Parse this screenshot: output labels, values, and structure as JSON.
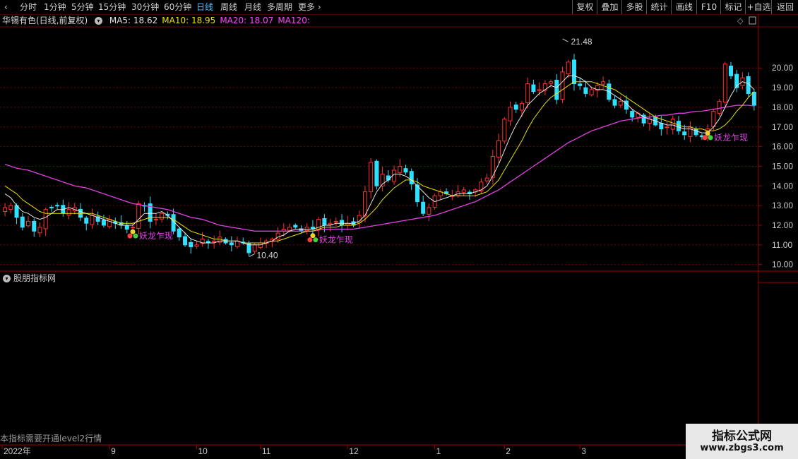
{
  "toolbar": {
    "periods": [
      "分时",
      "1分钟",
      "5分钟",
      "15分钟",
      "30分钟",
      "60分钟",
      "日线",
      "周线",
      "月线",
      "多周期",
      "更多"
    ],
    "active": "日线",
    "right_buttons": [
      "复权",
      "叠加",
      "多股",
      "统计",
      "画线",
      "F10",
      "标记",
      "+自选",
      "返回"
    ]
  },
  "stock": {
    "title": "华锡有色(日线,前复权)",
    "ma_labels": [
      {
        "text": "MA5: 18.62",
        "color": "#e0e0e0"
      },
      {
        "text": "MA10: 18.95",
        "color": "#e8e000"
      },
      {
        "text": "MA20: 18.07",
        "color": "#ff44ff"
      },
      {
        "text": "MA120:",
        "color": "#ff44ff"
      }
    ]
  },
  "subpanel": {
    "title": "股朋指标网"
  },
  "footer": {
    "note": "本指标需要开通level2行情"
  },
  "watermark": {
    "line1": "指标公式网",
    "line2": "www.zbgs3.com"
  },
  "chart_data": {
    "type": "candlestick",
    "ylim": [
      9.7,
      22.2
    ],
    "yticks": [
      10.0,
      11.0,
      12.0,
      13.0,
      14.0,
      15.0,
      16.0,
      17.0,
      18.0,
      19.0,
      20.0
    ],
    "x_labels": [
      {
        "text": "2022年",
        "index": 0
      },
      {
        "text": "9",
        "index": 18
      },
      {
        "text": "10",
        "index": 33
      },
      {
        "text": "11",
        "index": 44
      },
      {
        "text": "12",
        "index": 59
      },
      {
        "text": "1",
        "index": 74
      },
      {
        "text": "2",
        "index": 86
      },
      {
        "text": "3",
        "index": 99
      }
    ],
    "annotations": {
      "max": {
        "text": "21.48",
        "index": 96,
        "value": 21.48
      },
      "min": {
        "text": "10.40",
        "index": 42,
        "value": 10.4
      }
    },
    "signal_label": "妖龙乍现",
    "signals": [
      22,
      53,
      121
    ],
    "candles_close": [
      12.9,
      13.0,
      12.4,
      11.9,
      12.2,
      11.7,
      11.9,
      12.8,
      12.9,
      13.0,
      12.6,
      12.8,
      12.9,
      12.4,
      12.1,
      12.5,
      12.2,
      12.0,
      12.3,
      12.1,
      12.0,
      11.8,
      11.9,
      13.1,
      13.0,
      12.2,
      12.3,
      12.6,
      12.5,
      11.7,
      11.4,
      11.0,
      10.9,
      11.0,
      11.3,
      11.1,
      11.2,
      11.4,
      11.1,
      11.0,
      11.2,
      11.1,
      10.6,
      11.0,
      11.1,
      11.2,
      11.3,
      11.6,
      11.8,
      11.9,
      11.9,
      11.7,
      11.9,
      11.8,
      12.3,
      12.0,
      12.1,
      12.2,
      12.0,
      12.1,
      12.0,
      12.5,
      13.7,
      15.2,
      14.0,
      14.6,
      14.3,
      14.8,
      15.0,
      14.7,
      14.1,
      13.2,
      12.6,
      12.9,
      13.5,
      13.7,
      13.6,
      13.5,
      13.7,
      13.8,
      13.6,
      13.8,
      14.2,
      14.4,
      15.5,
      16.3,
      17.4,
      18.0,
      17.9,
      18.2,
      19.2,
      18.8,
      18.9,
      19.2,
      19.3,
      18.4,
      19.8,
      20.3,
      19.2,
      19.1,
      18.7,
      18.9,
      19.1,
      19.3,
      18.4,
      18.1,
      18.3,
      17.9,
      17.5,
      17.7,
      17.2,
      17.4,
      17.1,
      16.9,
      17.0,
      17.4,
      16.8,
      16.6,
      17.0,
      16.6,
      16.5,
      16.9,
      17.8,
      18.3,
      20.2,
      19.6,
      19.0,
      19.5,
      18.7,
      18.1
    ],
    "overlay": {
      "ma5": [
        13.6,
        13.4,
        13.0,
        12.7,
        12.6,
        12.4,
        12.3,
        12.4,
        12.6,
        12.8,
        12.8,
        12.9,
        12.8,
        12.7,
        12.6,
        12.5,
        12.4,
        12.3,
        12.2,
        12.1,
        12.0,
        12.0,
        12.0,
        12.3,
        12.6,
        12.6,
        12.6,
        12.7,
        12.5,
        12.2,
        11.9,
        11.6,
        11.3,
        11.2,
        11.1,
        11.1,
        11.1,
        11.2,
        11.2,
        11.2,
        11.2,
        11.1,
        11.0,
        11.0,
        11.0,
        11.1,
        11.2,
        11.4,
        11.5,
        11.7,
        11.8,
        11.8,
        11.8,
        11.8,
        11.9,
        12.0,
        12.0,
        12.1,
        12.1,
        12.1,
        12.1,
        12.2,
        12.5,
        13.1,
        13.7,
        14.1,
        14.3,
        14.6,
        14.6,
        14.5,
        14.3,
        14.0,
        13.7,
        13.4,
        13.2,
        13.3,
        13.4,
        13.5,
        13.6,
        13.6,
        13.6,
        13.7,
        13.8,
        14.0,
        14.5,
        15.1,
        15.8,
        16.5,
        17.1,
        17.6,
        18.1,
        18.4,
        18.7,
        18.9,
        19.1,
        19.0,
        19.3,
        19.6,
        19.6,
        19.5,
        19.3,
        19.0,
        18.9,
        18.9,
        18.8,
        18.6,
        18.4,
        18.2,
        17.9,
        17.7,
        17.5,
        17.4,
        17.3,
        17.2,
        17.1,
        17.1,
        17.0,
        16.9,
        16.9,
        16.8,
        16.7,
        16.7,
        17.0,
        17.4,
        18.0,
        18.6,
        19.1,
        19.3,
        19.2,
        18.9
      ],
      "ma10": [
        14.0,
        13.8,
        13.6,
        13.3,
        13.1,
        12.9,
        12.7,
        12.6,
        12.6,
        12.6,
        12.6,
        12.6,
        12.6,
        12.6,
        12.6,
        12.6,
        12.5,
        12.4,
        12.3,
        12.2,
        12.1,
        12.1,
        12.1,
        12.2,
        12.3,
        12.4,
        12.4,
        12.4,
        12.4,
        12.3,
        12.1,
        11.9,
        11.7,
        11.6,
        11.5,
        11.4,
        11.3,
        11.3,
        11.2,
        11.2,
        11.2,
        11.1,
        11.1,
        11.1,
        11.1,
        11.1,
        11.2,
        11.2,
        11.3,
        11.4,
        11.5,
        11.6,
        11.7,
        11.7,
        11.8,
        11.9,
        11.9,
        11.9,
        12.0,
        12.0,
        12.0,
        12.1,
        12.3,
        12.6,
        12.9,
        13.3,
        13.6,
        13.9,
        14.1,
        14.3,
        14.3,
        14.2,
        14.0,
        13.9,
        13.8,
        13.7,
        13.6,
        13.5,
        13.5,
        13.5,
        13.5,
        13.5,
        13.6,
        13.7,
        14.0,
        14.3,
        14.8,
        15.3,
        15.8,
        16.3,
        16.9,
        17.4,
        17.8,
        18.2,
        18.5,
        18.7,
        18.9,
        19.1,
        19.3,
        19.3,
        19.3,
        19.3,
        19.2,
        19.1,
        19.0,
        18.9,
        18.7,
        18.5,
        18.3,
        18.1,
        17.9,
        17.7,
        17.5,
        17.4,
        17.3,
        17.2,
        17.1,
        17.0,
        17.0,
        16.9,
        16.9,
        16.8,
        16.8,
        16.9,
        17.1,
        17.4,
        17.8,
        18.1,
        18.5,
        18.8
      ],
      "ma20": [
        15.1,
        15.0,
        14.9,
        14.85,
        14.8,
        14.7,
        14.6,
        14.5,
        14.4,
        14.3,
        14.2,
        14.1,
        14.0,
        13.95,
        13.9,
        13.8,
        13.7,
        13.6,
        13.5,
        13.4,
        13.3,
        13.2,
        13.1,
        13.05,
        13.0,
        12.95,
        12.9,
        12.85,
        12.8,
        12.7,
        12.6,
        12.5,
        12.4,
        12.35,
        12.3,
        12.2,
        12.1,
        12.0,
        11.95,
        11.9,
        11.85,
        11.8,
        11.75,
        11.7,
        11.7,
        11.7,
        11.7,
        11.7,
        11.7,
        11.7,
        11.7,
        11.7,
        11.7,
        11.7,
        11.75,
        11.8,
        11.8,
        11.8,
        11.8,
        11.8,
        11.8,
        11.85,
        11.9,
        11.95,
        12.0,
        12.05,
        12.1,
        12.15,
        12.2,
        12.25,
        12.3,
        12.35,
        12.4,
        12.45,
        12.5,
        12.6,
        12.7,
        12.8,
        12.9,
        13.0,
        13.1,
        13.2,
        13.35,
        13.5,
        13.65,
        13.8,
        14.0,
        14.2,
        14.4,
        14.6,
        14.8,
        15.0,
        15.2,
        15.4,
        15.6,
        15.8,
        16.0,
        16.2,
        16.35,
        16.5,
        16.65,
        16.8,
        16.9,
        17.0,
        17.1,
        17.2,
        17.3,
        17.35,
        17.4,
        17.45,
        17.5,
        17.5,
        17.55,
        17.6,
        17.6,
        17.65,
        17.7,
        17.7,
        17.75,
        17.8,
        17.8,
        17.85,
        17.9,
        17.95,
        18.0,
        18.05,
        18.1,
        18.1,
        18.1,
        18.07
      ]
    }
  }
}
